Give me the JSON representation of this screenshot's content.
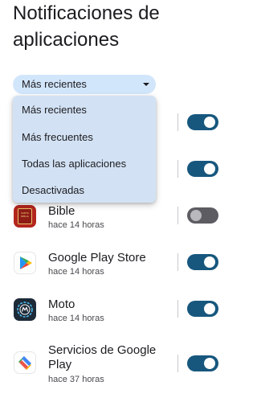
{
  "header": {
    "title": "Notificaciones de\naplicaciones"
  },
  "filter": {
    "selected": "Más recientes",
    "options": [
      "Más recientes",
      "Más frecuentes",
      "Todas las aplicaciones",
      "Desactivadas"
    ]
  },
  "apps": [
    {
      "name": "Bible",
      "subtitle": "hace 14 horas",
      "enabled": false,
      "icon": "bible-app-icon"
    },
    {
      "name": "Google Play Store",
      "subtitle": "hace 14 horas",
      "enabled": true,
      "icon": "google-play-store-icon"
    },
    {
      "name": "Moto",
      "subtitle": "hace 14 horas",
      "enabled": true,
      "icon": "moto-app-icon"
    },
    {
      "name": "Servicios de Google\nPlay",
      "subtitle": "hace 37 horas",
      "enabled": true,
      "icon": "google-play-services-icon"
    }
  ],
  "bible_icon_text": "SANTA BIBLIA",
  "colors": {
    "toggle_on": "#17577e",
    "toggle_off": "#5c5c62",
    "chip_background": "#d2e6fb",
    "menu_background": "#d2e2f4"
  }
}
